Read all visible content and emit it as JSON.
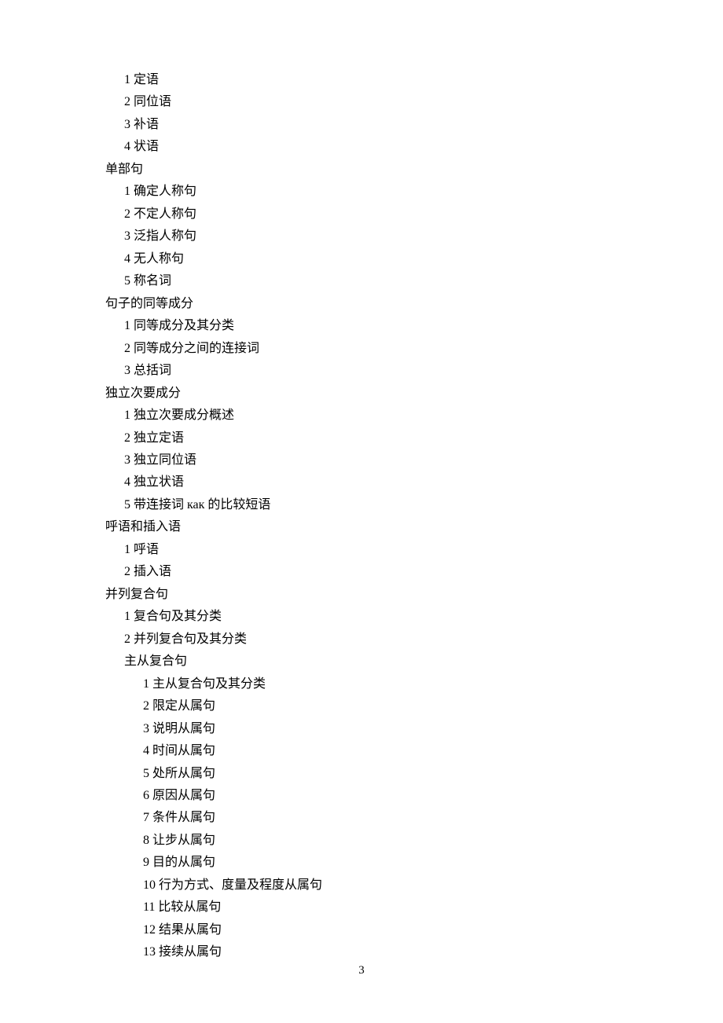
{
  "lines": [
    {
      "indent": "indent-1",
      "text": "1 定语"
    },
    {
      "indent": "indent-1",
      "text": "2 同位语"
    },
    {
      "indent": "indent-1",
      "text": "3 补语"
    },
    {
      "indent": "indent-1",
      "text": "4 状语"
    },
    {
      "indent": "indent-0",
      "text": "单部句"
    },
    {
      "indent": "indent-1",
      "text": "1 确定人称句"
    },
    {
      "indent": "indent-1",
      "text": "2 不定人称句"
    },
    {
      "indent": "indent-1",
      "text": "3 泛指人称句"
    },
    {
      "indent": "indent-1",
      "text": "4 无人称句"
    },
    {
      "indent": "indent-1",
      "text": "5 称名词"
    },
    {
      "indent": "indent-0",
      "text": "句子的同等成分"
    },
    {
      "indent": "indent-1",
      "text": "1 同等成分及其分类"
    },
    {
      "indent": "indent-1",
      "text": "2 同等成分之间的连接词"
    },
    {
      "indent": "indent-1",
      "text": "3 总括词"
    },
    {
      "indent": "indent-0",
      "text": "独立次要成分"
    },
    {
      "indent": "indent-1",
      "text": "1 独立次要成分概述"
    },
    {
      "indent": "indent-1",
      "text": "2 独立定语"
    },
    {
      "indent": "indent-1",
      "text": "3 独立同位语"
    },
    {
      "indent": "indent-1",
      "text": "4 独立状语"
    },
    {
      "indent": "indent-1",
      "text": "5 带连接词 как 的比较短语"
    },
    {
      "indent": "indent-0",
      "text": "呼语和插入语"
    },
    {
      "indent": "indent-1",
      "text": "1 呼语"
    },
    {
      "indent": "indent-1",
      "text": "2 插入语"
    },
    {
      "indent": "indent-0",
      "text": "并列复合句"
    },
    {
      "indent": "indent-1",
      "text": "1 复合句及其分类"
    },
    {
      "indent": "indent-1",
      "text": "2 并列复合句及其分类"
    },
    {
      "indent": "indent-1b",
      "text": "主从复合句"
    },
    {
      "indent": "indent-2",
      "text": "1 主从复合句及其分类"
    },
    {
      "indent": "indent-2",
      "text": "2 限定从属句"
    },
    {
      "indent": "indent-2",
      "text": "3 说明从属句"
    },
    {
      "indent": "indent-2",
      "text": "4 时间从属句"
    },
    {
      "indent": "indent-2",
      "text": "5 处所从属句"
    },
    {
      "indent": "indent-2",
      "text": "6 原因从属句"
    },
    {
      "indent": "indent-2",
      "text": "7 条件从属句"
    },
    {
      "indent": "indent-2",
      "text": "8 让步从属句"
    },
    {
      "indent": "indent-2",
      "text": "9 目的从属句"
    },
    {
      "indent": "indent-2",
      "text": "10 行为方式、度量及程度从属句"
    },
    {
      "indent": "indent-2",
      "text": "11 比较从属句"
    },
    {
      "indent": "indent-2",
      "text": "12 结果从属句"
    },
    {
      "indent": "indent-2",
      "text": "13 接续从属句"
    }
  ],
  "page_number": "3"
}
